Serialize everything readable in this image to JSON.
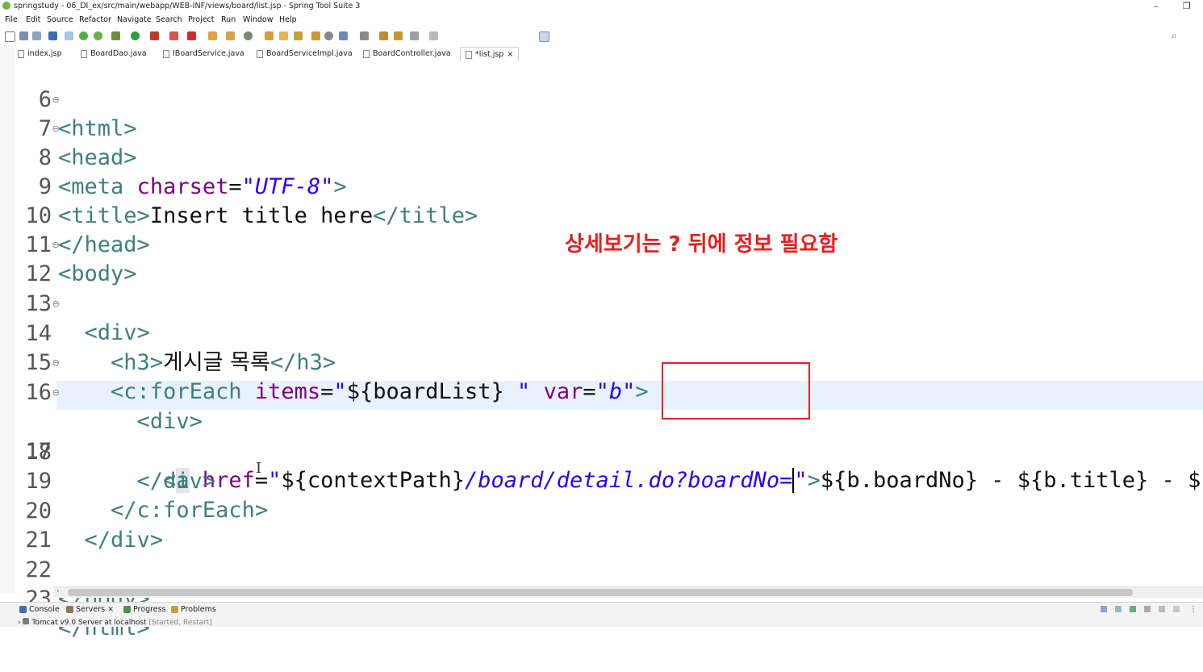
{
  "window": {
    "title": "springstudy - 06_DI_ex/src/main/webapp/WEB-INF/views/board/list.jsp - Spring Tool Suite 3",
    "minimize": "–",
    "restore": "❐"
  },
  "menu": [
    "File",
    "Edit",
    "Source",
    "Refactor",
    "Navigate",
    "Search",
    "Project",
    "Run",
    "Window",
    "Help"
  ],
  "tabs": [
    {
      "label": "index.jsp",
      "active": false
    },
    {
      "label": "BoardDao.java",
      "active": false
    },
    {
      "label": "IBoardService.java",
      "active": false
    },
    {
      "label": "BoardServiceImpl.java",
      "active": false
    },
    {
      "label": "BoardController.java",
      "active": false
    },
    {
      "label": "*list.jsp",
      "active": true,
      "close": "×"
    }
  ],
  "editor": {
    "line_numbers": [
      "6",
      "7",
      "8",
      "9",
      "10",
      "11",
      "12",
      "13",
      "14",
      "15",
      "16",
      "17",
      "18",
      "19",
      "20",
      "21",
      "22",
      "23"
    ],
    "cursor_marker": "I",
    "tokens": {
      "html_open": "html",
      "head_open": "head",
      "meta": "meta",
      "charset_attr": "charset",
      "charset_val": "\"UTF-8\"",
      "title": "title",
      "title_text": "Insert title here",
      "head_close": "head",
      "body_open": "body",
      "div": "div",
      "h3": "h3",
      "h3_text": "게시글 목록",
      "foreach": "c:forEach",
      "items_attr": "items",
      "items_q": "\"",
      "items_expr": "${boardList}",
      "items_q2": "\"",
      "var_attr": "var",
      "var_val": "\"b\"",
      "a_tag": "a",
      "href_attr": "href",
      "href_q": "\"",
      "href_expr": "${contextPath}",
      "href_path": "/board/detail.do",
      "href_query": "?boardNo=",
      "href_end": "\"",
      "line17_text": "${b.boardNo} - ${b.title} - ${b.",
      "body_close": "body",
      "html_close": "html",
      "lt": "<",
      "gt": ">",
      "lt_slash": "</",
      "eq": "="
    }
  },
  "annotation": "상세보기는 ? 뒤에 정보 필요함",
  "bottom_panel": {
    "tabs": [
      {
        "label": "Console"
      },
      {
        "label": "Servers",
        "close": "×"
      },
      {
        "label": "Progress"
      },
      {
        "label": "Problems"
      }
    ],
    "server_row": "Tomcat v9.0 Server at localhost",
    "server_status": "[Started, Restart]"
  },
  "colors": {
    "tag": "#3f7f7f",
    "attribute": "#7f007f",
    "string": "#2a00ff",
    "annotation": "#e81e1e",
    "highlight_box": "#e8212a"
  }
}
